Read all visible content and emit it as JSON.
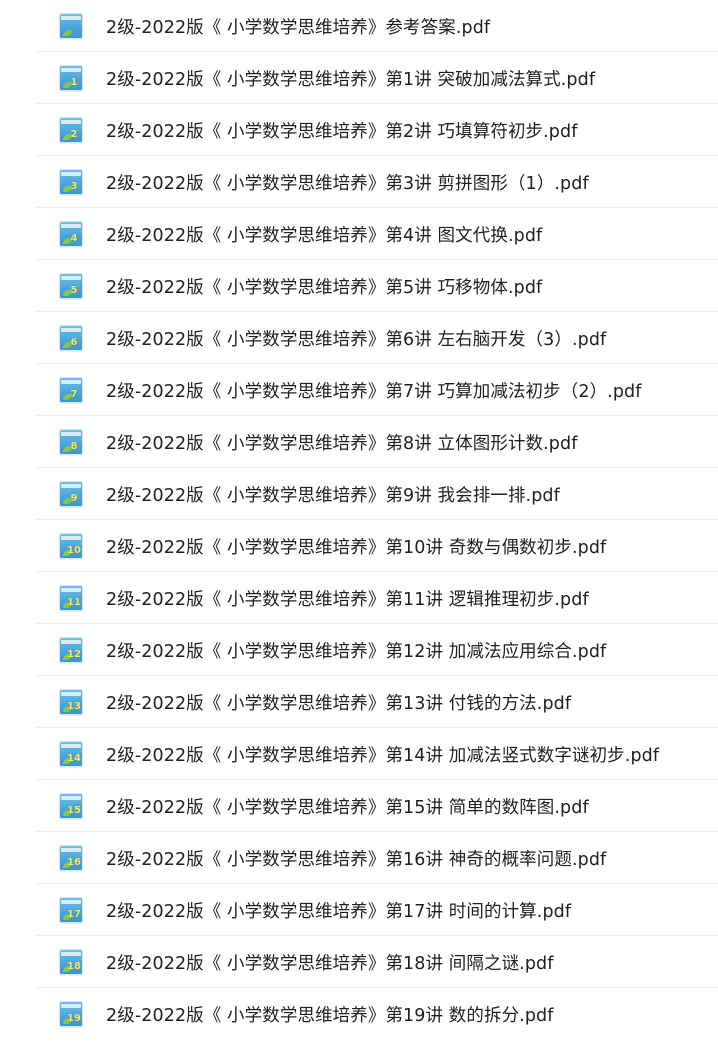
{
  "files": [
    {
      "name": "2级-2022版《 小学数学思维培养》参考答案.pdf",
      "thumb_label": ""
    },
    {
      "name": "2级-2022版《 小学数学思维培养》第1讲 突破加减法算式.pdf",
      "thumb_label": "1"
    },
    {
      "name": "2级-2022版《 小学数学思维培养》第2讲 巧填算符初步.pdf",
      "thumb_label": "2"
    },
    {
      "name": "2级-2022版《 小学数学思维培养》第3讲 剪拼图形（1）.pdf",
      "thumb_label": "3"
    },
    {
      "name": "2级-2022版《 小学数学思维培养》第4讲 图文代换.pdf",
      "thumb_label": "4"
    },
    {
      "name": "2级-2022版《 小学数学思维培养》第5讲 巧移物体.pdf",
      "thumb_label": "5"
    },
    {
      "name": "2级-2022版《 小学数学思维培养》第6讲 左右脑开发（3）.pdf",
      "thumb_label": "6"
    },
    {
      "name": "2级-2022版《 小学数学思维培养》第7讲 巧算加减法初步（2）.pdf",
      "thumb_label": "7"
    },
    {
      "name": "2级-2022版《 小学数学思维培养》第8讲 立体图形计数.pdf",
      "thumb_label": "8"
    },
    {
      "name": "2级-2022版《 小学数学思维培养》第9讲 我会排一排.pdf",
      "thumb_label": "9"
    },
    {
      "name": "2级-2022版《 小学数学思维培养》第10讲 奇数与偶数初步.pdf",
      "thumb_label": "10"
    },
    {
      "name": "2级-2022版《 小学数学思维培养》第11讲 逻辑推理初步.pdf",
      "thumb_label": "11"
    },
    {
      "name": "2级-2022版《 小学数学思维培养》第12讲 加减法应用综合.pdf",
      "thumb_label": "12"
    },
    {
      "name": "2级-2022版《 小学数学思维培养》第13讲 付钱的方法.pdf",
      "thumb_label": "13"
    },
    {
      "name": "2级-2022版《 小学数学思维培养》第14讲 加减法竖式数字谜初步.pdf",
      "thumb_label": "14"
    },
    {
      "name": "2级-2022版《 小学数学思维培养》第15讲 简单的数阵图.pdf",
      "thumb_label": "15"
    },
    {
      "name": "2级-2022版《 小学数学思维培养》第16讲 神奇的概率问题.pdf",
      "thumb_label": "16"
    },
    {
      "name": "2级-2022版《 小学数学思维培养》第17讲 时间的计算.pdf",
      "thumb_label": "17"
    },
    {
      "name": "2级-2022版《 小学数学思维培养》第18讲 间隔之谜.pdf",
      "thumb_label": "18"
    },
    {
      "name": "2级-2022版《 小学数学思维培养》第19讲 数的拆分.pdf",
      "thumb_label": "19"
    }
  ],
  "colors": {
    "thumb_blue": "#4aa6da",
    "row_divider": "#ececec",
    "text": "#1f1f1f"
  }
}
